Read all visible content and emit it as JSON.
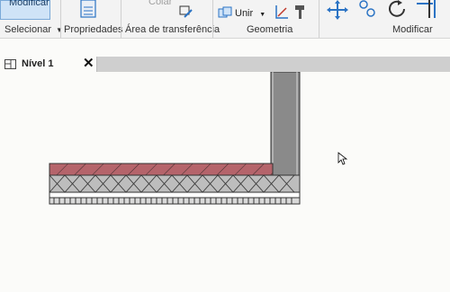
{
  "ribbon": {
    "modify_button_label": "Modificar",
    "paste_label": "Colar",
    "join_label": "Unir",
    "groups": {
      "select": "Selecionar",
      "properties": "Propriedades",
      "clipboard": "Área de transferência",
      "geometry": "Geometria",
      "modify": "Modificar"
    }
  },
  "view_tab": {
    "label": "Nível 1",
    "close_glyph": "✕"
  },
  "colors": {
    "accent": "#2b73c4",
    "floor_finish": "#b5646b",
    "insulation_fill": "#bdbdbd",
    "wall": "#8a8a8a"
  }
}
